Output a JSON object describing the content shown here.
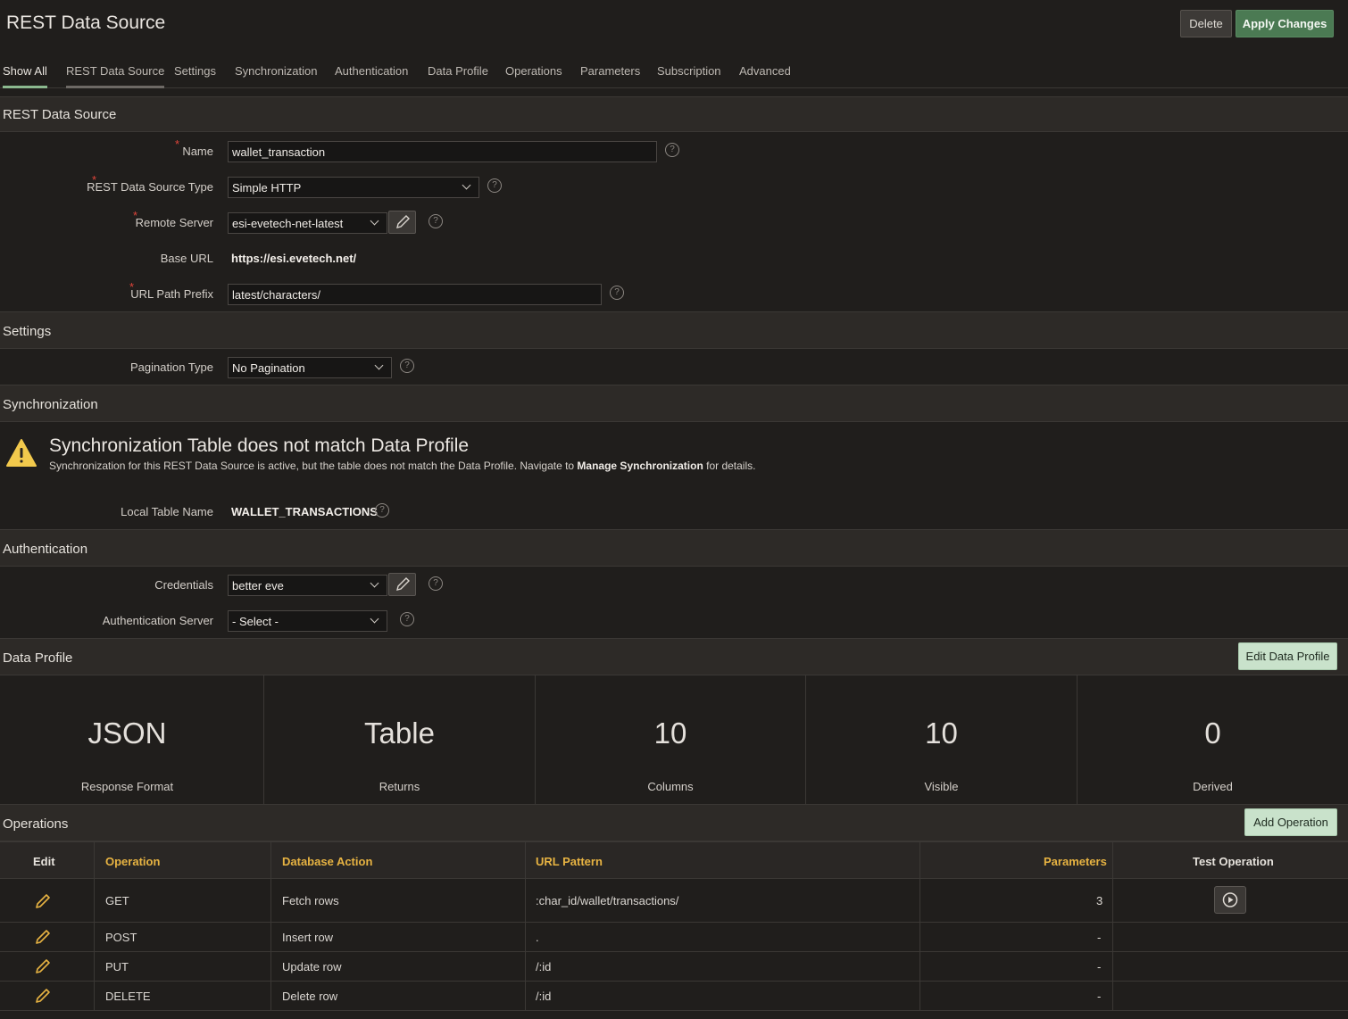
{
  "header": {
    "title": "REST Data Source",
    "delete_label": "Delete",
    "apply_label": "Apply Changes"
  },
  "tabs": [
    "Show All",
    "REST Data Source",
    "Settings",
    "Synchronization",
    "Authentication",
    "Data Profile",
    "Operations",
    "Parameters",
    "Subscription",
    "Advanced"
  ],
  "rest_source": {
    "section_title": "REST Data Source",
    "name_label": "Name",
    "name_value": "wallet_transaction",
    "type_label": "REST Data Source Type",
    "type_value": "Simple HTTP",
    "server_label": "Remote Server",
    "server_value": "esi-evetech-net-latest",
    "base_url_label": "Base URL",
    "base_url_value": "https://esi.evetech.net/",
    "prefix_label": "URL Path Prefix",
    "prefix_value": "latest/characters/"
  },
  "settings": {
    "section_title": "Settings",
    "pagination_label": "Pagination Type",
    "pagination_value": "No Pagination"
  },
  "sync": {
    "section_title": "Synchronization",
    "warning_title": "Synchronization Table does not match Data Profile",
    "warning_text_a": "Synchronization for this REST Data Source is active, but the table does not match the Data Profile. Navigate to ",
    "warning_link": "Manage Synchronization",
    "warning_text_b": " for details.",
    "local_table_label": "Local Table Name",
    "local_table_value": "WALLET_TRANSACTIONS"
  },
  "auth": {
    "section_title": "Authentication",
    "credentials_label": "Credentials",
    "credentials_value": "better eve",
    "auth_server_label": "Authentication Server",
    "auth_server_value": "- Select -"
  },
  "data_profile": {
    "section_title": "Data Profile",
    "edit_label": "Edit Data Profile",
    "stats": [
      {
        "value": "JSON",
        "label": "Response Format"
      },
      {
        "value": "Table",
        "label": "Returns"
      },
      {
        "value": "10",
        "label": "Columns"
      },
      {
        "value": "10",
        "label": "Visible"
      },
      {
        "value": "0",
        "label": "Derived"
      }
    ]
  },
  "operations": {
    "section_title": "Operations",
    "add_label": "Add Operation",
    "columns": {
      "edit": "Edit",
      "operation": "Operation",
      "db_action": "Database Action",
      "url_pattern": "URL Pattern",
      "parameters": "Parameters",
      "test": "Test Operation"
    },
    "rows": [
      {
        "operation": "GET",
        "db_action": "Fetch rows",
        "url": ":char_id/wallet/transactions/",
        "params": "3"
      },
      {
        "operation": "POST",
        "db_action": "Insert row",
        "url": ".",
        "params": "-"
      },
      {
        "operation": "PUT",
        "db_action": "Update row",
        "url": "/:id",
        "params": "-"
      },
      {
        "operation": "DELETE",
        "db_action": "Delete row",
        "url": "/:id",
        "params": "-"
      }
    ]
  }
}
